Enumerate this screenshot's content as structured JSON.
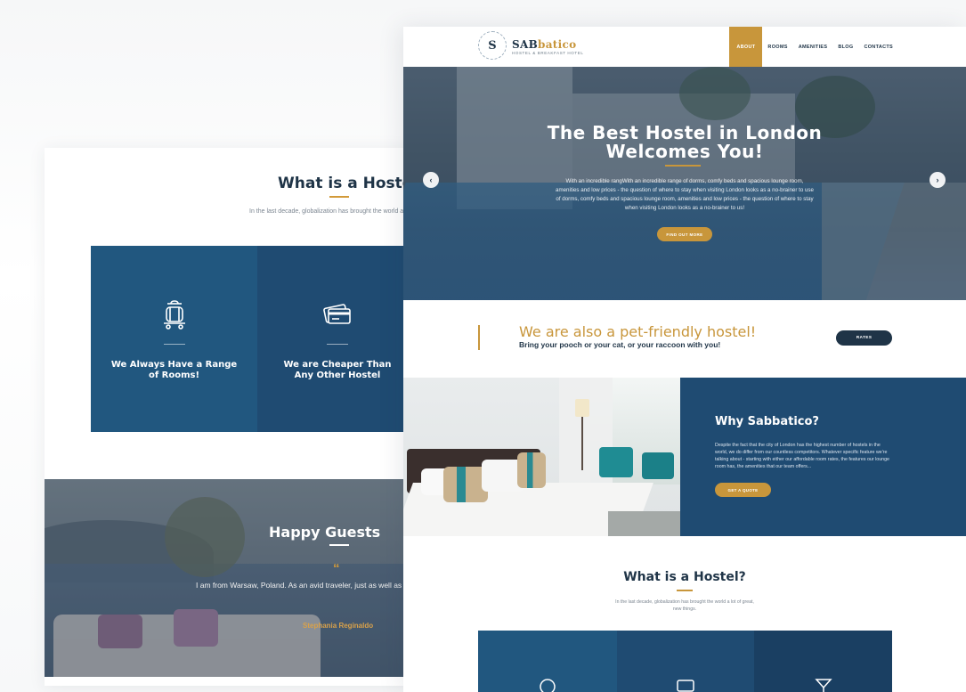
{
  "back_page": {
    "what_title": "What is a Hostel?",
    "what_text": "In the last decade, globalization has brought the world a lot of great, new things.",
    "features": [
      {
        "label": "We Always Have a Range of Rooms!",
        "icon": "luggage-cart-icon"
      },
      {
        "label": "We are Cheaper Than Any Other Hostel",
        "icon": "credit-card-icon"
      }
    ],
    "guests": {
      "title": "Happy Guests",
      "quote_icon": "“",
      "quote": "I am from Warsaw, Poland. As an avid traveler, just as well as all traveling! This time of the year last year me and 4 friends of mine London and we've stayed at this hostel!",
      "author": "Stephania Reginaldo"
    }
  },
  "front_page": {
    "logo": {
      "badge": "S",
      "name_a": "SAB",
      "name_b": "batico",
      "tagline": "HOSTEL & BREAKFAST HOTEL"
    },
    "nav": [
      "ABOUT",
      "ROOMS",
      "AMENITIES",
      "BLOG",
      "CONTACTS"
    ],
    "hero": {
      "title_line1": "The Best Hostel in London",
      "title_line2": "Welcomes You!",
      "text": "With an incredible rangWith an incredible range of dorms, comfy beds and spacious lounge room, amenities and low prices - the question of where to stay when visiting London looks as a no-brainer to use of dorms, comfy beds and spacious lounge room, amenities and low prices - the question of where to stay when visiting London looks as a no-brainer to us!",
      "button": "FIND OUT MORE",
      "prev": "‹",
      "next": "›"
    },
    "pet": {
      "title": "We are also a pet-friendly hostel!",
      "subtitle": "Bring your pooch or your cat, or your raccoon with you!",
      "button": "RATES"
    },
    "why": {
      "title": "Why Sabbatico?",
      "text": "Despite the fact that the city of London has the highest number of hostels in the world, we do differ from our countless competitors. Whatever specific feature we're talking about - starting with either our affordable room rates, the features our lounge room has, the amenities that our team offers...",
      "button": "GET A QUOTE"
    },
    "what": {
      "title": "What is a Hostel?",
      "text": "In the last decade, globalization has brought the world a lot of great, new things."
    }
  },
  "colors": {
    "navy": "#1f3447",
    "blue": "#21577f",
    "gold": "#c8963b"
  }
}
